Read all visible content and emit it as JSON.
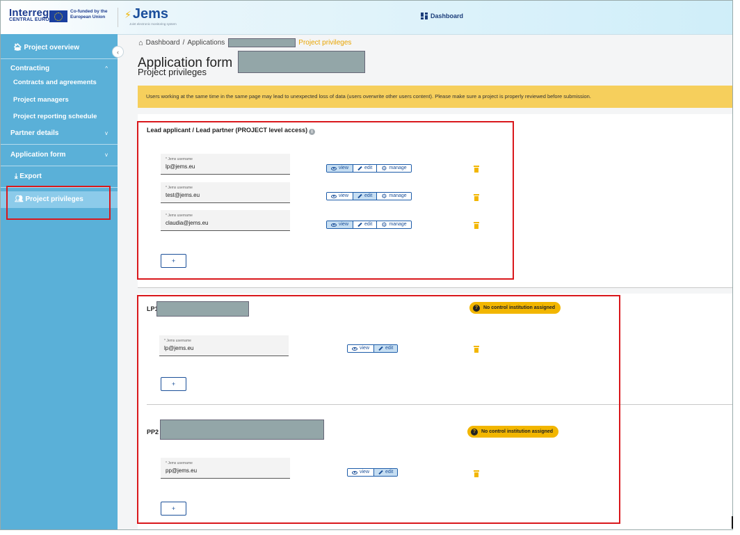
{
  "header": {
    "interreg_logo": "Interreg",
    "interreg_sub": "CENTRAL EUROPE",
    "cofunded": "Co-funded by the European Union",
    "jems_logo": "Jems",
    "jems_sub": "Joint electronic monitoring system",
    "dashboard_link": "Dashboard"
  },
  "sidebar": {
    "project_overview": "Project overview",
    "contracting": "Contracting",
    "contracts_and_agreements": "Contracts and agreements",
    "project_managers": "Project managers",
    "project_reporting_schedule": "Project reporting schedule",
    "partner_details": "Partner details",
    "application_form": "Application form",
    "export": "Export",
    "project_privileges": "Project privileges"
  },
  "breadcrumb": {
    "dashboard": "Dashboard",
    "separator": "/",
    "applications": "Applications",
    "current": "Project privileges"
  },
  "page": {
    "title": "Application form",
    "subtitle": "Project privileges",
    "warning": "Users working at the same time in the same page may lead to unexpected loss of data (users overwrite other users content). Please make sure a project is properly reviewed before submission."
  },
  "labels": {
    "username_label": "* Jems username",
    "view": "view",
    "edit": "edit",
    "manage": "manage",
    "add": "+",
    "no_control": "No control institution assigned",
    "info": "i",
    "question": "?"
  },
  "lead_section": {
    "title": "Lead applicant / Lead partner (PROJECT level access)",
    "users": [
      {
        "username": "lp@jems.eu",
        "selected": "view"
      },
      {
        "username": "test@jems.eu",
        "selected": "edit"
      },
      {
        "username": "claudia@jems.eu",
        "selected": "view"
      }
    ]
  },
  "partners": [
    {
      "code": "LP1",
      "users": [
        {
          "username": "lp@jems.eu",
          "selected": "edit"
        }
      ]
    },
    {
      "code": "PP2",
      "users": [
        {
          "username": "pp@jems.eu",
          "selected": "edit"
        }
      ]
    }
  ]
}
